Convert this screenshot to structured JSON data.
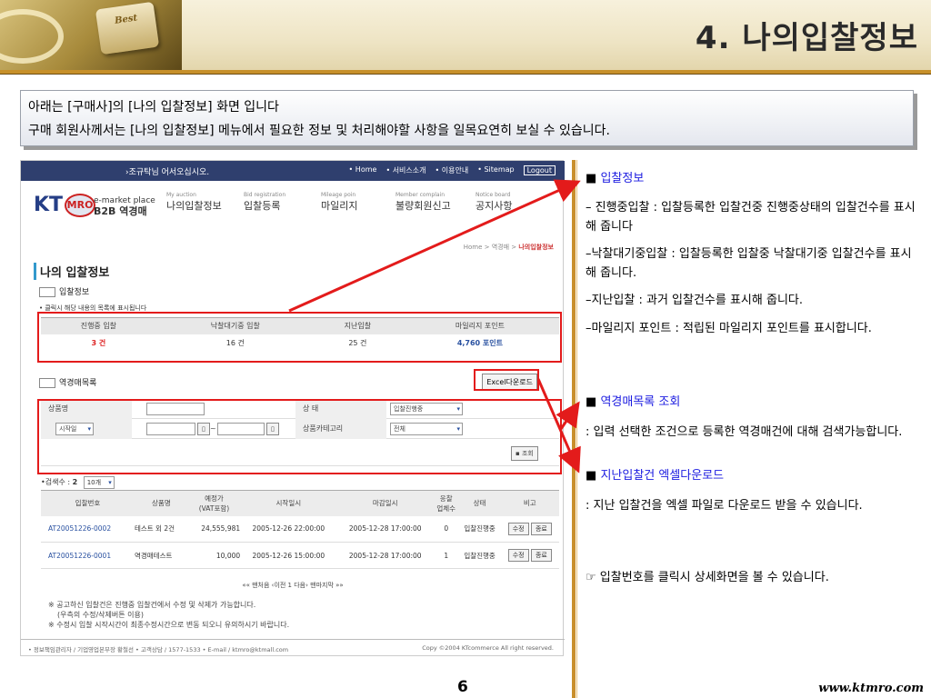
{
  "header": {
    "title": "4. 나의입찰정보",
    "image_caption": "Best"
  },
  "intro": {
    "line1": "아래는 [구매사]의 [나의 입찰정보] 화면 입니다",
    "line2": "구매 회원사께서는 [나의 입찰정보] 메뉴에서 필요한 정보 및 처리해야할 사항을 일목요연히 보실 수 있습니다."
  },
  "shot": {
    "welcome": "›조규탁님 어서오십시오.",
    "toplinks": [
      "• Home",
      "• 서비스소개",
      "• 이용안내",
      "• Sitemap",
      "Logout"
    ],
    "logo": "KT",
    "logo_mark": "MRO",
    "logo_line1": "e-market place",
    "logo_line2": "B2B 역경매",
    "nav": [
      {
        "en": "My auction",
        "ko": "나의입찰정보"
      },
      {
        "en": "Bid registration",
        "ko": "입찰등록"
      },
      {
        "en": "Mileage poin",
        "ko": "마일리지"
      },
      {
        "en": "Member complain",
        "ko": "불량회원신고"
      },
      {
        "en": "Notice board",
        "ko": "공지사항"
      }
    ],
    "crumb": "Home > 역경매 >",
    "crumb_current": "나의입찰정보",
    "page_title": "나의 입찰정보",
    "sub1": "입찰정보",
    "note": "• 클릭시 해당 내용의 목록에 표시됩니다",
    "summary": {
      "headers": [
        "진행중 입찰",
        "낙찰대기중 입찰",
        "지난입찰",
        "마일리지 포인트"
      ],
      "values": [
        "3 건",
        "16 건",
        "25 건",
        "4,760 포인트"
      ]
    },
    "sub2": "역경매목록",
    "excel": "Excel다운로드",
    "form": {
      "name_label": "상품명",
      "status_label": "상 태",
      "status_value": "입찰진행중",
      "start_label": "시작일",
      "sep": "~",
      "cat_label": "상품카테고리",
      "cat_value": "전체",
      "search": "조회"
    },
    "count_label": "•검색수 : ",
    "count_value": "2",
    "page_size": "10개",
    "list": {
      "headers": [
        "입찰번호",
        "상품명",
        "예정가\n(VAT포함)",
        "시작일시",
        "마감일시",
        "응찰\n업체수",
        "상태",
        "비고"
      ],
      "rows": [
        {
          "id": "AT20051226-0002",
          "name": "테스트 외 2건",
          "price": "24,555,981",
          "start": "2005-12-26 22:00:00",
          "end": "2005-12-28 17:00:00",
          "bidders": "0",
          "status": "입찰진행중",
          "b1": "수정",
          "b2": "종료"
        },
        {
          "id": "AT20051226-0001",
          "name": "역경매테스트",
          "price": "10,000",
          "start": "2005-12-26 15:00:00",
          "end": "2005-12-28 17:00:00",
          "bidders": "1",
          "status": "입찰진행중",
          "b1": "수정",
          "b2": "종료"
        }
      ]
    },
    "pager": "«« 맨처음 ‹이전  1  다음› 맨마지막 »»",
    "notes": [
      "※ 공고하신 입찰건은 진행중 입찰건에서 수정 및 삭제가 가능합니다.",
      "(우측의 수정/삭제버튼 이용)",
      "※ 수정시 입찰 시작시간이 최종수정시간으로 변동 되오니 유의하시기 바랍니다."
    ],
    "footer_left": "• 정보책임관리자 / 기업영업본부장 황철선  • 고객상담 / 1577-1533  • E-mail / ktmro@ktmall.com",
    "footer_right": "Copy ©2004 KTcommerce All right reserved."
  },
  "notes": {
    "s1_title": "입찰정보",
    "s1_l1": " – 진행중입찰 : 입찰등록한 입찰건중 진행중상태의 입찰건수를 표시해 줍니다",
    "s1_l2": "–낙찰대기중입찰 : 입찰등록한 입찰중 낙찰대기중 입찰건수를 표시해 줍니다.",
    "s1_l3": "–지난입찰 : 과거 입찰건수를 표시해 줍니다.",
    "s1_l4": "–마일리지 포인트 : 적립된 마일리지 포인트를 표시합니다.",
    "s2_title": "역경매목록 조회",
    "s2_l1": " : 입력 선택한 조건으로 등록한 역경매건에 대해 검색가능합니다.",
    "s3_title": "지난입찰건 엑셀다운로드",
    "s3_l1": " : 지난 입찰건을 엑셀 파일로 다운로드 받을 수 있습니다.",
    "tip": "☞ 입찰번호를 클릭시 상세화면을 볼 수 있습니다.",
    "square": "■"
  },
  "page_number": "6",
  "site": "www.ktmro.com"
}
